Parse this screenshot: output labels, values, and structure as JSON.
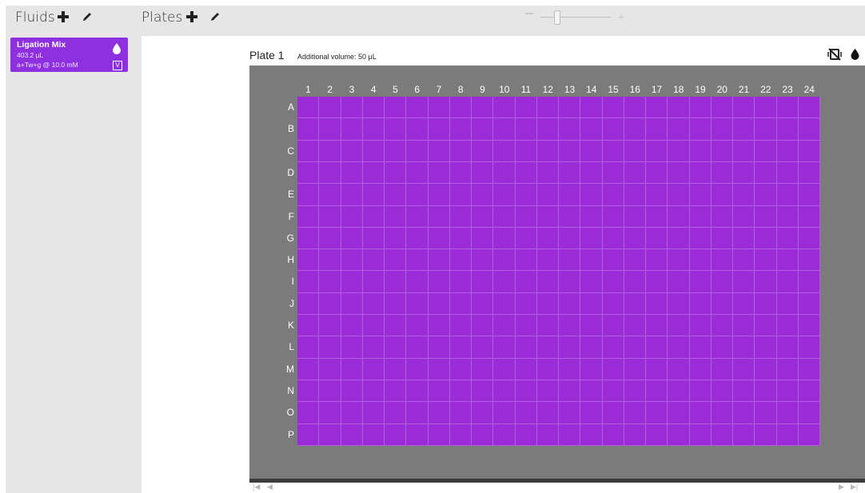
{
  "fluids": {
    "title": "Fluids",
    "add_icon": "plus-icon",
    "edit_icon": "pencil-icon",
    "items": [
      {
        "name": "Ligation Mix",
        "volume": "403.2 µL",
        "composition": "a+Tw+g @ 10.0 mM",
        "badge": "V",
        "icon": "droplet-icon",
        "color": "#8e2fe0"
      }
    ]
  },
  "plates": {
    "title": "Plates",
    "add_icon": "plus-icon",
    "edit_icon": "pencil-icon"
  },
  "zoom": {
    "level": 0.2
  },
  "plate": {
    "title": "Plate 1",
    "additional_volume": "Additional volume: 50 µL",
    "tools": [
      "no-shake-icon",
      "droplet-icon"
    ],
    "columns": [
      "1",
      "2",
      "3",
      "4",
      "5",
      "6",
      "7",
      "8",
      "9",
      "10",
      "11",
      "12",
      "13",
      "14",
      "15",
      "16",
      "17",
      "18",
      "19",
      "20",
      "21",
      "22",
      "23",
      "24"
    ],
    "rows": [
      "A",
      "B",
      "C",
      "D",
      "E",
      "F",
      "G",
      "H",
      "I",
      "J",
      "K",
      "L",
      "M",
      "N",
      "O",
      "P"
    ],
    "well_color": "#9a2bd6",
    "background_color": "#7b7b7b"
  },
  "scroll": {
    "first": "first-page-icon",
    "prev": "prev-icon",
    "next": "next-icon",
    "last": "last-page-icon"
  }
}
